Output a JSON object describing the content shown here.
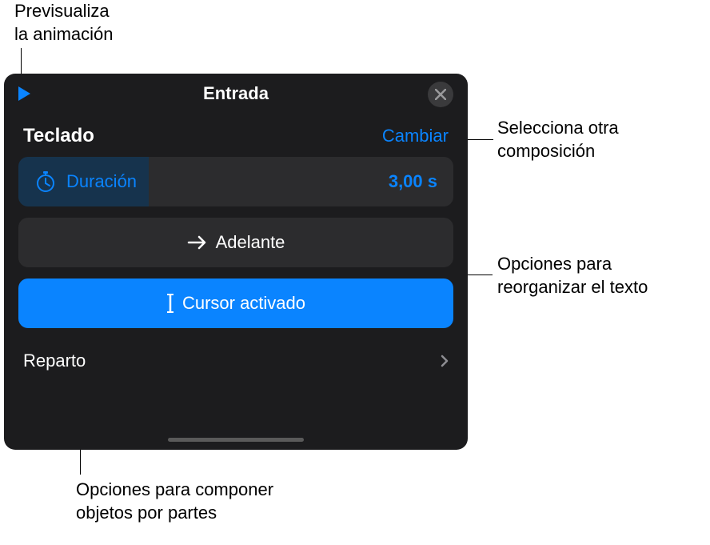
{
  "callouts": {
    "preview": "Previsualiza\nla animación",
    "change": "Selecciona otra\ncomposición",
    "direction": "Opciones para\nreorganizar el texto",
    "delivery": "Opciones para componer\nobjetos por partes"
  },
  "panel": {
    "title": "Entrada",
    "effect_name": "Teclado",
    "change_label": "Cambiar",
    "duration": {
      "label": "Duración",
      "value": "3,00 s"
    },
    "direction_label": "Adelante",
    "cursor_label": "Cursor activado",
    "delivery_label": "Reparto"
  }
}
